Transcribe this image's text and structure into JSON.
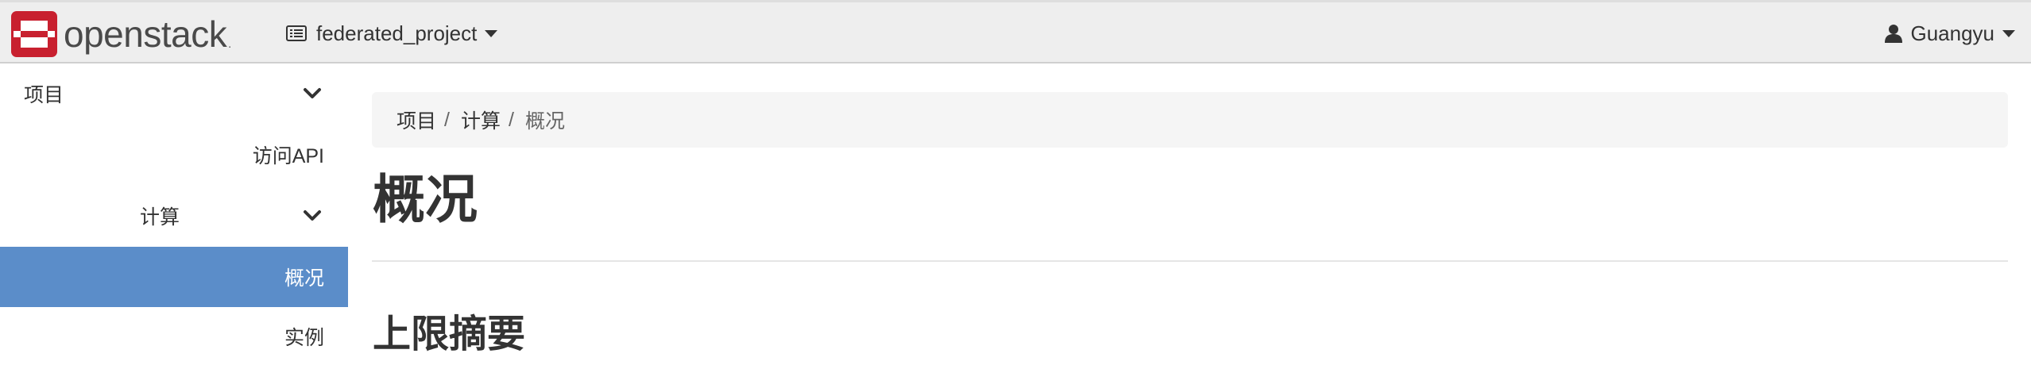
{
  "navbar": {
    "brand": {
      "text": "openstack",
      "registered": "."
    },
    "project_switcher": {
      "label": "federated_project",
      "icon": "list-icon"
    },
    "user_menu": {
      "label": "Guangyu",
      "icon": "user-icon"
    }
  },
  "sidebar": {
    "items": [
      {
        "label": "项目",
        "expanded": true,
        "icon": "chevron-down-icon"
      },
      {
        "label": "访问API"
      },
      {
        "label": "计算",
        "expanded": true,
        "icon": "chevron-down-icon"
      },
      {
        "label": "概况",
        "active": true
      },
      {
        "label": "实例"
      }
    ]
  },
  "breadcrumb": {
    "items": [
      "项目",
      "计算",
      "概况"
    ],
    "separator": "/"
  },
  "page": {
    "title": "概况",
    "section_title": "上限摘要"
  },
  "colors": {
    "navbar_bg": "#eeeeee",
    "brand_red": "#c8202f",
    "active_nav": "#5b8dc9",
    "breadcrumb_bg": "#f5f5f5"
  }
}
